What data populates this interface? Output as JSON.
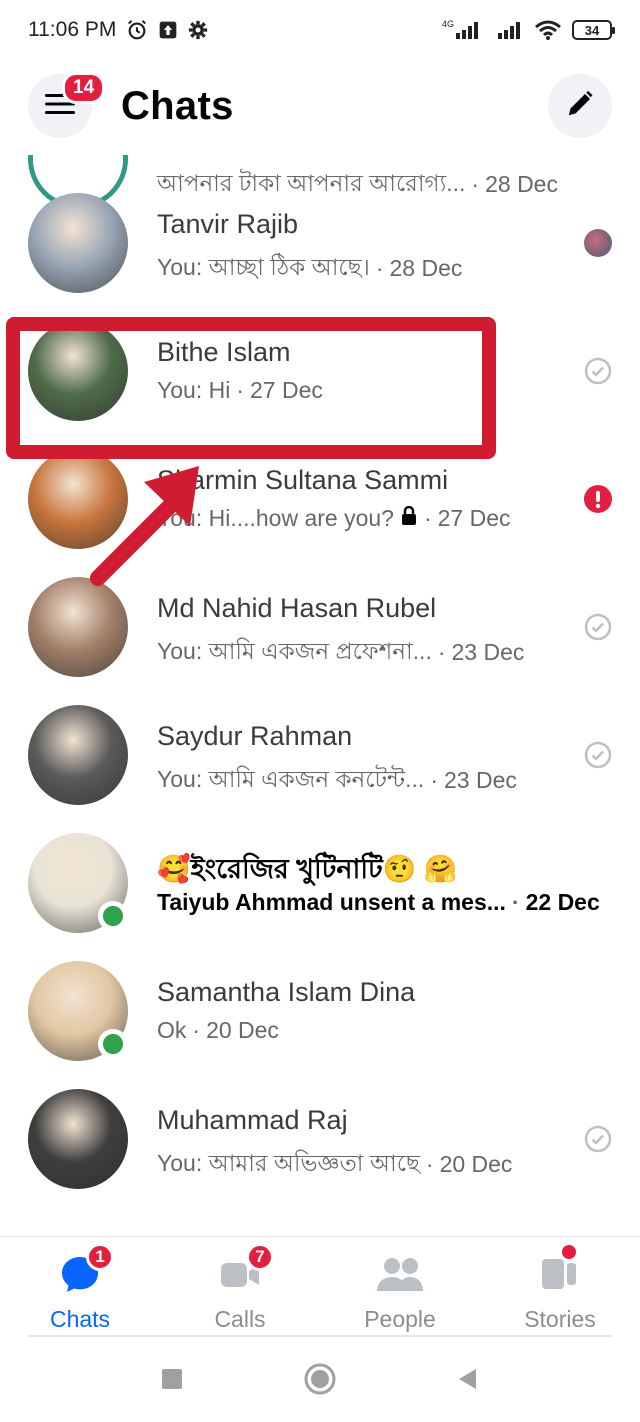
{
  "statusbar": {
    "time": "11:06 PM",
    "network": "4G",
    "battery": "34"
  },
  "header": {
    "title": "Chats",
    "menu_badge": "14"
  },
  "chats": [
    {
      "name": "",
      "preview": "আপনার টাকা আপনার আরোগ্য...",
      "date": "28 Dec",
      "status": "none",
      "avatar_color": "#dfe6e2",
      "partial": true
    },
    {
      "name": "Tanvir Rajib",
      "preview": "You: আচ্ছা ঠিক আছে।",
      "date": "28 Dec",
      "status": "seen-avatar",
      "avatar_color": "#9aa6b5"
    },
    {
      "name": "Bithe Islam",
      "preview": "You: Hi",
      "date": "27 Dec",
      "status": "sent",
      "avatar_color": "#4f6b4a"
    },
    {
      "name": "Sharmin Sultana Sammi",
      "preview": "You: Hi....how are you?",
      "date": "27 Dec",
      "status": "error",
      "avatar_color": "#c9763e",
      "lock": true
    },
    {
      "name": "Md Nahid Hasan Rubel",
      "preview": "You: আমি একজন প্রফেশনা...",
      "date": "23 Dec",
      "status": "sent",
      "avatar_color": "#a3806a"
    },
    {
      "name": "Saydur Rahman",
      "preview": "You: আমি একজন কনটেন্ট...",
      "date": "23 Dec",
      "status": "sent",
      "avatar_color": "#5a5a5a"
    },
    {
      "name": "🥰ইংরেজির খুটিনাটি🤨 🤗",
      "preview": "Taiyub Ahmmad unsent a mes...",
      "date": "22 Dec",
      "status": "none",
      "avatar_color": "#e8e4d6",
      "unread": true,
      "online": true
    },
    {
      "name": "Samantha Islam Dina",
      "preview": "Ok",
      "date": "20 Dec",
      "status": "none",
      "avatar_color": "#e2c7a3",
      "online": true
    },
    {
      "name": "Muhammad Raj",
      "preview": "You: আমার অভিজ্ঞতা আছে",
      "date": "20 Dec",
      "status": "sent",
      "avatar_color": "#3e3e3e"
    }
  ],
  "nav": [
    {
      "label": "Chats",
      "badge": "1",
      "active": true
    },
    {
      "label": "Calls",
      "badge": "7",
      "active": false
    },
    {
      "label": "People",
      "badge": "",
      "active": false
    },
    {
      "label": "Stories",
      "badge": "",
      "dot": true,
      "active": false
    }
  ],
  "colors": {
    "accent": "#0866ff",
    "badge": "#e41e3f",
    "highlight": "#d01c30",
    "online": "#31a24c"
  }
}
